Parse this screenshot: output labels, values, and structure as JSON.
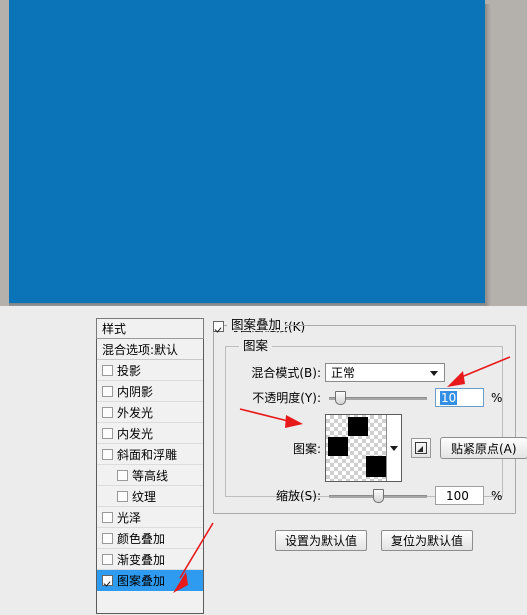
{
  "canvas": {
    "fill_color": "#0b74b8",
    "surround_color": "#b4b0ac"
  },
  "dialog": {
    "background_color": "#ececec",
    "styles_panel": {
      "header": "样式",
      "items": [
        {
          "label": "混合选项:默认",
          "type": "option",
          "checkbox": false,
          "indent": false,
          "selected": false
        },
        {
          "label": "投影",
          "type": "effect",
          "checkbox": true,
          "checked": false,
          "indent": false,
          "selected": false
        },
        {
          "label": "内阴影",
          "type": "effect",
          "checkbox": true,
          "checked": false,
          "indent": false,
          "selected": false
        },
        {
          "label": "外发光",
          "type": "effect",
          "checkbox": true,
          "checked": false,
          "indent": false,
          "selected": false
        },
        {
          "label": "内发光",
          "type": "effect",
          "checkbox": true,
          "checked": false,
          "indent": false,
          "selected": false
        },
        {
          "label": "斜面和浮雕",
          "type": "effect",
          "checkbox": true,
          "checked": false,
          "indent": false,
          "selected": false
        },
        {
          "label": "等高线",
          "type": "effect",
          "checkbox": true,
          "checked": false,
          "indent": true,
          "selected": false
        },
        {
          "label": "纹理",
          "type": "effect",
          "checkbox": true,
          "checked": false,
          "indent": true,
          "selected": false
        },
        {
          "label": "光泽",
          "type": "effect",
          "checkbox": true,
          "checked": false,
          "indent": false,
          "selected": false
        },
        {
          "label": "颜色叠加",
          "type": "effect",
          "checkbox": true,
          "checked": false,
          "indent": false,
          "selected": false
        },
        {
          "label": "渐变叠加",
          "type": "effect",
          "checkbox": true,
          "checked": false,
          "indent": false,
          "selected": false
        },
        {
          "label": "图案叠加",
          "type": "effect",
          "checkbox": true,
          "checked": true,
          "indent": false,
          "selected": true
        }
      ],
      "selection_color": "#2e9bf0"
    },
    "panel": {
      "outer_legend": "图案叠加",
      "inner_legend": "图案",
      "blend_mode": {
        "label": "混合模式(B):",
        "value": "正常",
        "icon": "chevron-down-icon"
      },
      "opacity": {
        "label": "不透明度(Y):",
        "value": "10",
        "unit": "%",
        "slider_percent": 10,
        "selected": true
      },
      "pattern": {
        "label": "图案:",
        "swatch_icon": "checkerboard-pattern-swatch",
        "dropdown_icon": "chevron-down-icon",
        "new_pattern_icon": "new-pattern-icon",
        "snap_button": "贴紧原点(A)"
      },
      "scale": {
        "label": "缩放(S):",
        "value": "100",
        "unit": "%",
        "slider_percent": 45
      },
      "link_with_layer": {
        "label": "与图层链接(K)",
        "checked": true
      },
      "buttons": {
        "set_default": "设置为默认值",
        "reset_default": "复位为默认值"
      }
    }
  },
  "annotations": {
    "arrow_color": "#e8191b",
    "arrows": [
      {
        "name": "arrow-to-opacity-field",
        "target": "opacity value field"
      },
      {
        "name": "arrow-to-pattern-swatch",
        "target": "pattern swatch"
      },
      {
        "name": "arrow-to-pattern-overlay-item",
        "target": "图案叠加 list item"
      }
    ]
  }
}
